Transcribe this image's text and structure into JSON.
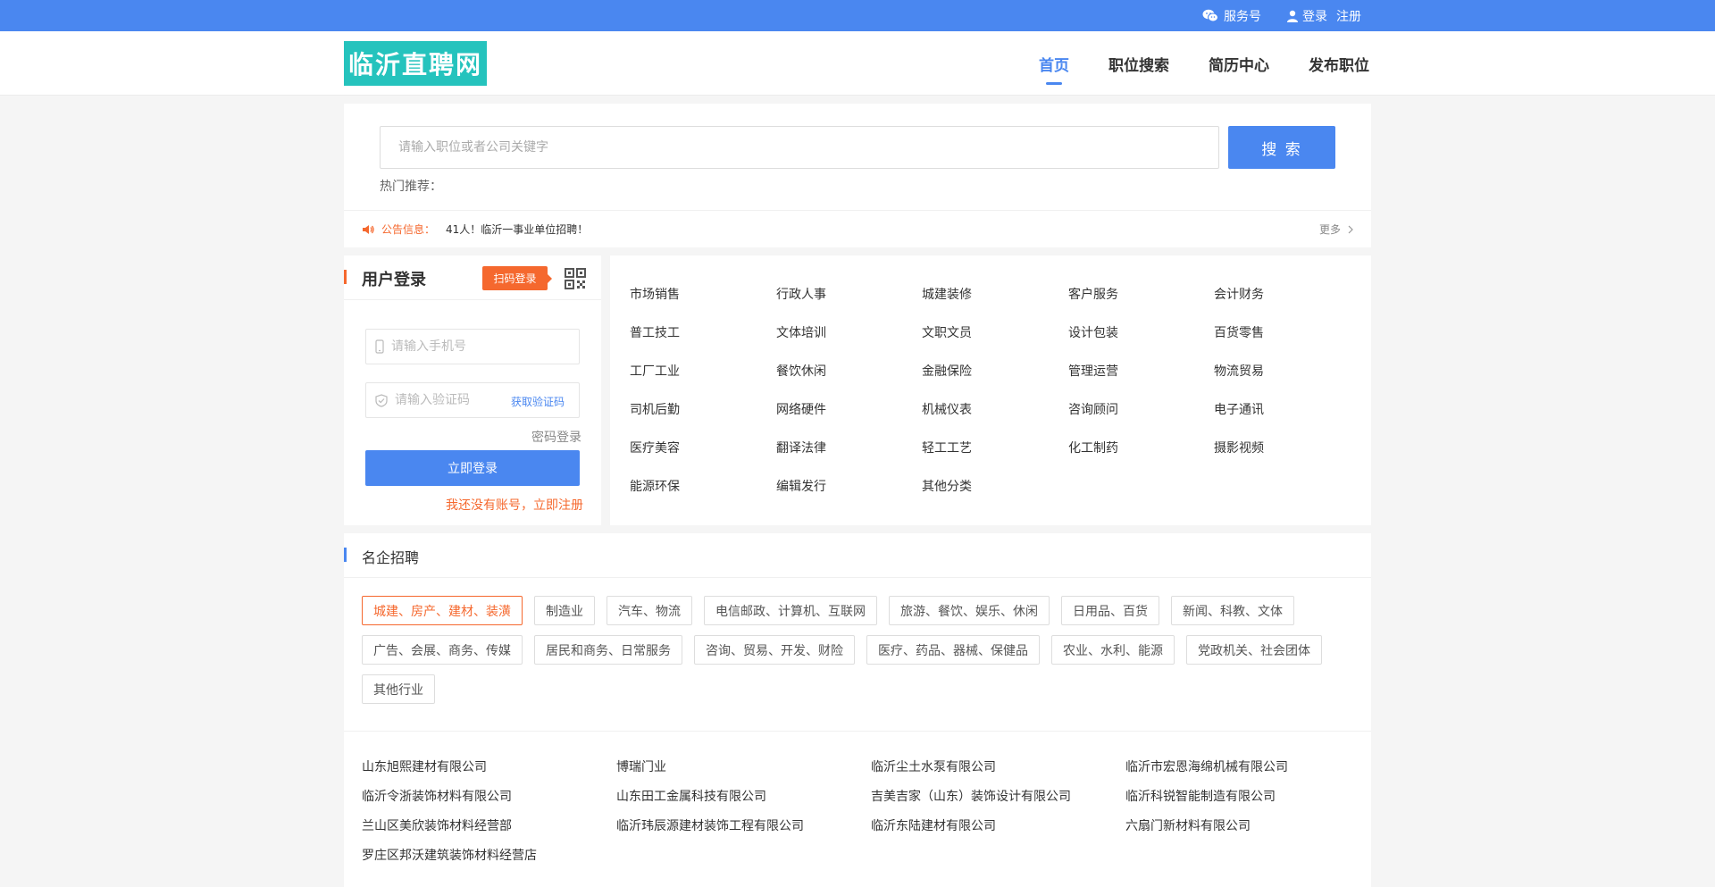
{
  "topbar": {
    "service": "服务号",
    "login": "登录",
    "register": "注册"
  },
  "header": {
    "logo": "临沂直聘网",
    "nav": [
      {
        "label": "首页",
        "active": true
      },
      {
        "label": "职位搜索",
        "active": false
      },
      {
        "label": "简历中心",
        "active": false
      },
      {
        "label": "发布职位",
        "active": false
      }
    ]
  },
  "search": {
    "placeholder": "请输入职位或者公司关键字",
    "button": "搜 索",
    "hot_label": "热门推荐："
  },
  "notice": {
    "label": "公告信息：",
    "text": "41人！临沂一事业单位招聘！",
    "more": "更多"
  },
  "login": {
    "title": "用户登录",
    "qr_tag": "扫码登录",
    "phone_placeholder": "请输入手机号",
    "code_placeholder": "请输入验证码",
    "get_code": "获取验证码",
    "password_login": "密码登录",
    "submit": "立即登录",
    "register_link": "我还没有账号，立即注册"
  },
  "categories": [
    "市场销售",
    "行政人事",
    "城建装修",
    "客户服务",
    "会计财务",
    "普工技工",
    "文体培训",
    "文职文员",
    "设计包装",
    "百货零售",
    "工厂工业",
    "餐饮休闲",
    "金融保险",
    "管理运营",
    "物流贸易",
    "司机后勤",
    "网络硬件",
    "机械仪表",
    "咨询顾问",
    "电子通讯",
    "医疗美容",
    "翻译法律",
    "轻工工艺",
    "化工制药",
    "摄影视频",
    "能源环保",
    "编辑发行",
    "其他分类"
  ],
  "famous": {
    "title": "名企招聘",
    "tags": [
      "城建、房产、建材、装潢",
      "制造业",
      "汽车、物流",
      "电信邮政、计算机、互联网",
      "旅游、餐饮、娱乐、休闲",
      "日用品、百货",
      "新闻、科教、文体",
      "广告、会展、商务、传媒",
      "居民和商务、日常服务",
      "咨询、贸易、开发、财险",
      "医疗、药品、器械、保健品",
      "农业、水利、能源",
      "党政机关、社会团体",
      "其他行业"
    ],
    "active_tag": "城建、房产、建材、装潢",
    "companies": [
      "山东旭熙建材有限公司",
      "博瑞门业",
      "临沂尘土水泵有限公司",
      "临沂市宏恩海绵机械有限公司",
      "临沂令浙装饰材料有限公司",
      "山东田工金属科技有限公司",
      "吉美吉家（山东）装饰设计有限公司",
      "临沂科锐智能制造有限公司",
      "兰山区美欣装饰材料经营部",
      "临沂玮辰源建材装饰工程有限公司",
      "临沂东陆建材有限公司",
      "六扇门新材料有限公司",
      "罗庄区邦沃建筑装饰材料经营店"
    ]
  },
  "colors": {
    "primary": "#4a87f0",
    "accent": "#f5682e",
    "logo_bg": "#25c3bd"
  }
}
